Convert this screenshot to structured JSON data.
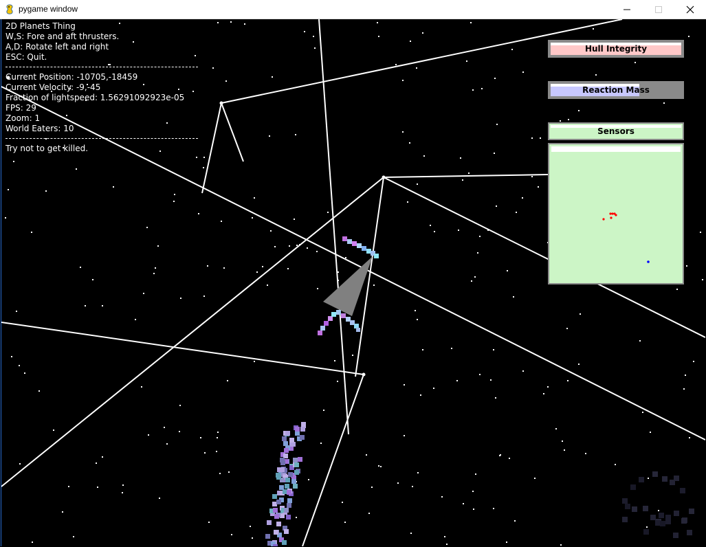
{
  "window": {
    "title": "pygame window",
    "minimize_icon": "minimize-icon",
    "maximize_icon": "maximize-icon",
    "close_icon": "close-icon"
  },
  "hud": {
    "game_title": "2D Planets Thing",
    "controls": [
      "W,S: Fore and aft thrusters.",
      "A,D: Rotate left and right",
      "ESC: Quit."
    ],
    "stats": [
      "Current Position: -10705,-18459",
      "Current Velocity: -9,-45",
      "Fraction of lightspeed: 1.56291092923e-05",
      "FPS: 29",
      "Zoom: 1",
      "World Eaters: 10"
    ],
    "hint": "Try not to get killed."
  },
  "panels": {
    "hull": {
      "label": "Hull Integrity",
      "level": 1.0,
      "color": "#ffc8c8"
    },
    "reaction": {
      "label": "Reaction Mass",
      "level": 0.68,
      "color": "#c8c8ff"
    },
    "sensors": {
      "label": "Sensors",
      "color": "#ccf5c6",
      "contact_color": "#ff0000",
      "player_color": "#0000ff"
    }
  },
  "colors": {
    "background": "#000000",
    "lines": "#ffffff",
    "ship": "#808080",
    "bar_frame": "#8a8a8a"
  }
}
